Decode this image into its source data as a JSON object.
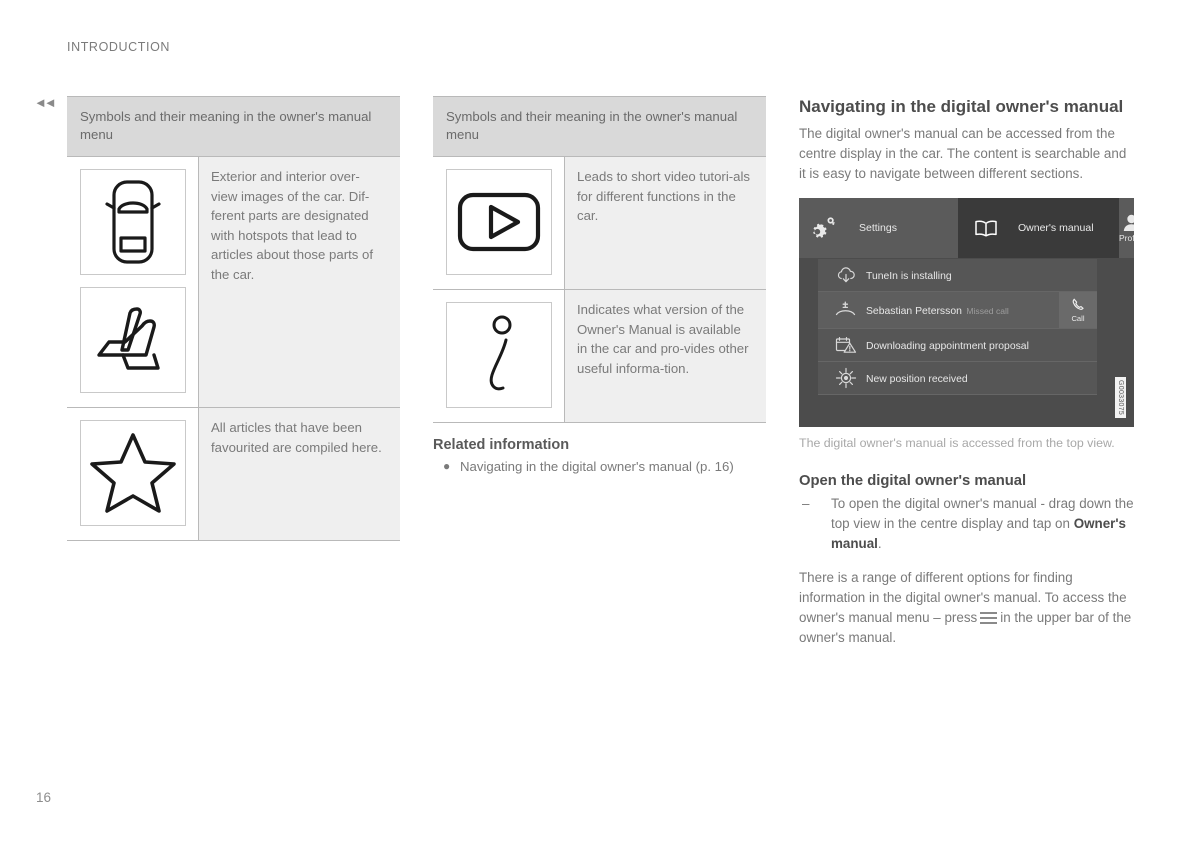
{
  "page": {
    "running_head": "INTRODUCTION",
    "page_number": "16",
    "back_marker_icon": "double-left-arrow-icon"
  },
  "table_1": {
    "header": "Symbols and their meaning in the owner's manual menu",
    "rows": [
      {
        "icons": [
          "car-top-view-icon",
          "car-seat-icon"
        ],
        "text": "Exterior and interior over-view images of the car. Dif-ferent parts are designated with hotspots that lead to articles about those parts of the car."
      },
      {
        "icons": [
          "star-icon"
        ],
        "text": "All articles that have been favourited are compiled here."
      }
    ]
  },
  "table_2": {
    "header": "Symbols and their meaning in the owner's manual menu",
    "rows": [
      {
        "icons": [
          "video-play-icon"
        ],
        "text": "Leads to short video tutori-als for different functions in the car."
      },
      {
        "icons": [
          "information-i-icon"
        ],
        "text": "Indicates what version of the Owner's Manual is available in the car and pro-vides other useful informa-tion."
      }
    ]
  },
  "related_information": {
    "title": "Related information",
    "items": [
      "Navigating in the digital owner's manual (p. 16)"
    ]
  },
  "right_column": {
    "heading": "Navigating in the digital owner's manual",
    "intro": "The digital owner's manual can be accessed from the centre display in the car. The content is searchable and it is easy to navigate between different sections.",
    "figure_caption": "The digital owner's manual is accessed from the top view.",
    "figure_code": "G0033075",
    "section_heading": "Open the digital owner's manual",
    "step_dash": "–",
    "step_text_part1": "To open the digital owner's manual - drag down the top view in the centre display and tap on ",
    "step_text_bold": "Owner's manual",
    "step_text_part3": ".",
    "closing_part1": "There is a range of different options for finding information in the digital owner's manual. To access the owner's manual menu – press",
    "closing_part2": "in the upper bar of the owner's manual."
  },
  "center_display": {
    "topbar": {
      "settings_label": "Settings",
      "settings_icon": "gears-icon",
      "manual_label": "Owner's manual",
      "manual_icon": "open-book-icon",
      "profile_label": "Profile",
      "profile_icon": "person-icon"
    },
    "notifications": [
      {
        "icon": "cloud-download-icon",
        "title": "TuneIn is installing",
        "subtitle": "",
        "action": ""
      },
      {
        "icon": "missed-call-icon",
        "title": "Sebastian Petersson",
        "subtitle": "Missed call",
        "action": "Call",
        "action_icon": "phone-icon"
      },
      {
        "icon": "calendar-warning-icon",
        "title": "Downloading appointment proposal",
        "subtitle": "",
        "action": ""
      },
      {
        "icon": "compass-position-icon",
        "title": "New position received",
        "subtitle": "",
        "action": ""
      }
    ]
  },
  "colors": {
    "table_header_bg": "#d9d9d9",
    "table_cell_bg": "#efefef",
    "body_text": "#7a7a7a",
    "heading_text": "#4d4d4d",
    "screen_bg": "#4c4c4c",
    "screen_topbar": "#5b5b5b",
    "screen_active_tab": "#3a3a3a"
  }
}
